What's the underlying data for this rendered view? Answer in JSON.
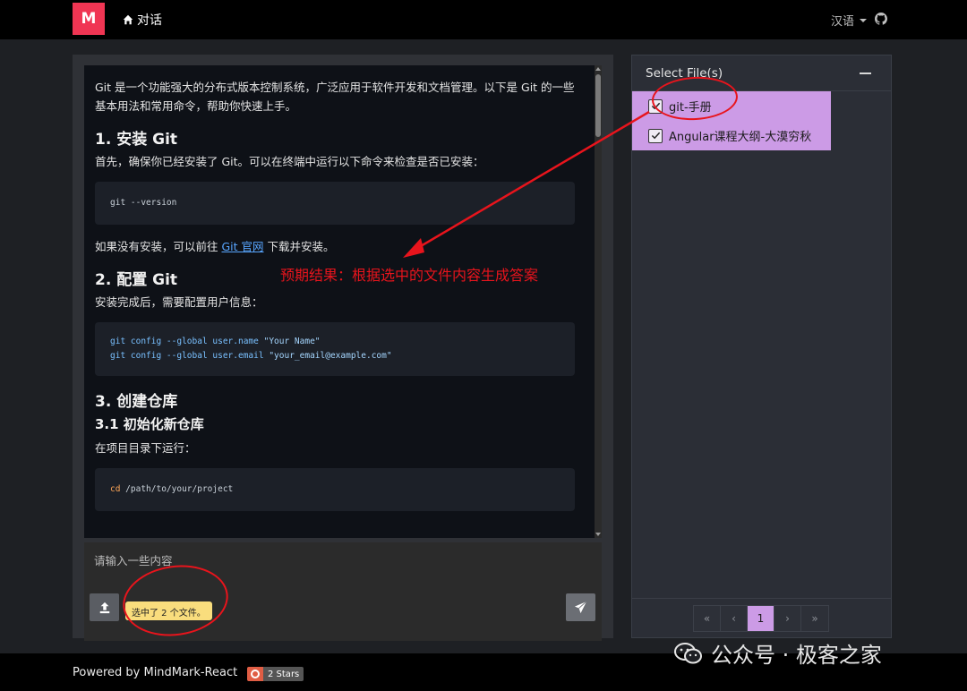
{
  "navbar": {
    "logo": "M",
    "chat_label": "对话",
    "language_label": "汉语"
  },
  "answer": {
    "intro": "Git 是一个功能强大的分布式版本控制系统，广泛应用于软件开发和文档管理。以下是 Git 的一些基本用法和常用命令，帮助你快速上手。",
    "section1_title": "1. 安装 Git",
    "section1_text": "首先，确保你已经安装了 Git。可以在终端中运行以下命令来检查是否已安装：",
    "code1": "git --version",
    "section1_after_prefix": "如果没有安装，可以前往 ",
    "section1_link": "Git 官网",
    "section1_after_suffix": " 下载并安装。",
    "section2_title": "2. 配置 Git",
    "section2_text": "安装完成后，需要配置用户信息：",
    "code2_line1_cmd": "git config --global user.name ",
    "code2_line1_str": "\"Your Name\"",
    "code2_line2_cmd": "git config --global user.email ",
    "code2_line2_str": "\"your_email@example.com\"",
    "section3_title": "3. 创建仓库",
    "section31_title": "3.1 初始化新仓库",
    "section31_text": "在项目目录下运行：",
    "code3_cmd": "cd",
    "code3_arg": " /path/to/your/project"
  },
  "input": {
    "placeholder": "请输入一些内容"
  },
  "upload_badge": "选中了 2 个文件。",
  "annotation": "预期结果：根据选中的文件内容生成答案",
  "file_panel": {
    "title": "Select File(s)",
    "files": [
      {
        "name": "git-手册",
        "checked": true
      },
      {
        "name": "Angular课程大纲-大漠穷秋",
        "checked": true
      }
    ],
    "pagination": {
      "first": "«",
      "prev": "‹",
      "current": "1",
      "next": "›",
      "last": "»"
    }
  },
  "footer": {
    "powered_by": "Powered by MindMark-React",
    "stars": "2 Stars"
  },
  "watermark": "公众号 · 极客之家",
  "colors": {
    "logo": "#f03553",
    "accent_purple": "#cc9be6",
    "annotation_red": "#e8141c",
    "badge_yellow": "#f9dd7d"
  }
}
